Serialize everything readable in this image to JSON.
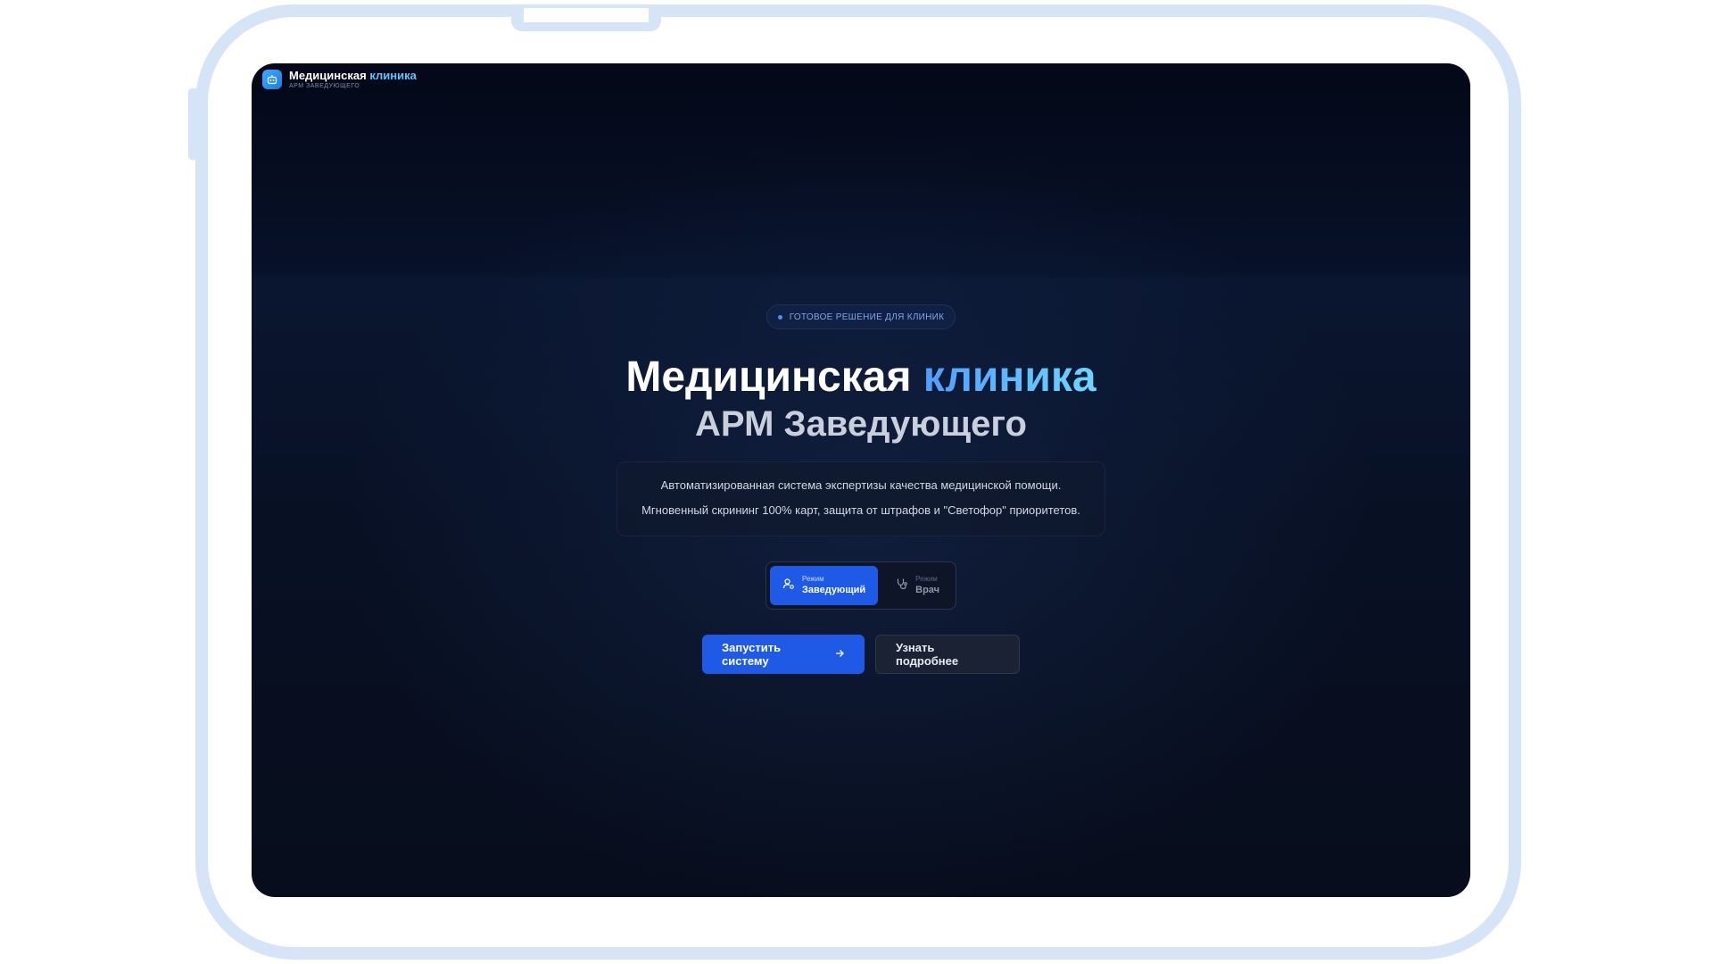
{
  "logo": {
    "title_main": "Медицинская",
    "title_accent": "клиника",
    "subtitle": "АРМ ЗАВЕДУЮЩЕГО"
  },
  "hero": {
    "badge": "ГОТОВОЕ РЕШЕНИЕ ДЛЯ КЛИНИК",
    "title_main": "Медицинская",
    "title_accent": "клиника",
    "title_line2": "АРМ Заведующего",
    "description_line1": "Автоматизированная система экспертизы качества медицинской помощи.",
    "description_line2": "Мгновенный скрининг 100% карт, защита от штрафов и \"Светофор\" приоритетов."
  },
  "mode_switch": {
    "options": [
      {
        "caption": "Режим",
        "label": "Заведующий",
        "active": true,
        "icon": "user-gear-icon"
      },
      {
        "caption": "Режим",
        "label": "Врач",
        "active": false,
        "icon": "stethoscope-icon"
      }
    ]
  },
  "actions": {
    "primary_label": "Запустить систему",
    "secondary_label": "Узнать подробнее"
  },
  "colors": {
    "accent": "#1f5ae6",
    "accent_text": "#5fc4ff",
    "background": "#070d1c"
  }
}
